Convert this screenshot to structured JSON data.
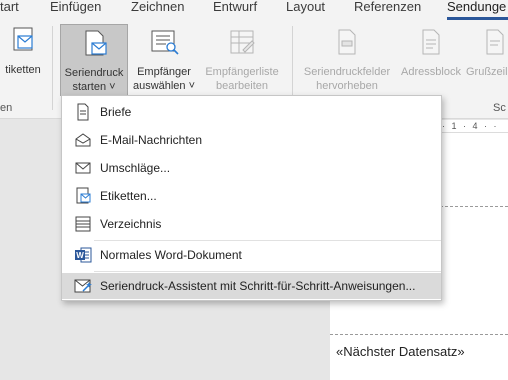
{
  "tabs": [
    {
      "label": "tart"
    },
    {
      "label": "Einfügen"
    },
    {
      "label": "Zeichnen"
    },
    {
      "label": "Entwurf"
    },
    {
      "label": "Layout"
    },
    {
      "label": "Referenzen"
    },
    {
      "label": "Sendunge"
    }
  ],
  "ribbon": {
    "etiketten": {
      "label": "tiketten",
      "icon": "labels-icon"
    },
    "seriendruck": {
      "line1": "Seriendruck",
      "line2": "starten ˅",
      "icon": "start-mail-merge-icon"
    },
    "empfaenger": {
      "line1": "Empfänger",
      "line2": "auswählen ˅",
      "icon": "select-recipients-icon"
    },
    "empfaengerliste": {
      "line1": "Empfängerliste",
      "line2": "bearbeiten",
      "icon": "edit-recipient-list-icon"
    },
    "felder": {
      "line1": "Seriendruckfelder",
      "line2": "hervorheben",
      "icon": "highlight-merge-fields-icon"
    },
    "adressblock": {
      "line1": "Adressblock",
      "icon": "address-block-icon"
    },
    "gruss": {
      "line1": "Grußzeil",
      "icon": "greeting-line-icon"
    },
    "group_left": "en",
    "group_right": "Sc"
  },
  "ruler_text": "· 1 · 4 · ·",
  "document": {
    "next_record": "«Nächster Datensatz»"
  },
  "menu": {
    "items": [
      {
        "label": "Briefe",
        "icon": "letter-icon"
      },
      {
        "label": "E-Mail-Nachrichten",
        "icon": "email-envelope-icon"
      },
      {
        "label": "Umschläge...",
        "icon": "envelope-icon"
      },
      {
        "label": "Etiketten...",
        "icon": "label-icon"
      },
      {
        "label": "Verzeichnis",
        "icon": "directory-icon"
      },
      {
        "label": "Normales Word-Dokument",
        "icon": "word-document-icon"
      },
      {
        "label": "Seriendruck-Assistent mit Schritt-für-Schritt-Anweisungen...",
        "icon": "mail-merge-wizard-icon"
      }
    ]
  }
}
